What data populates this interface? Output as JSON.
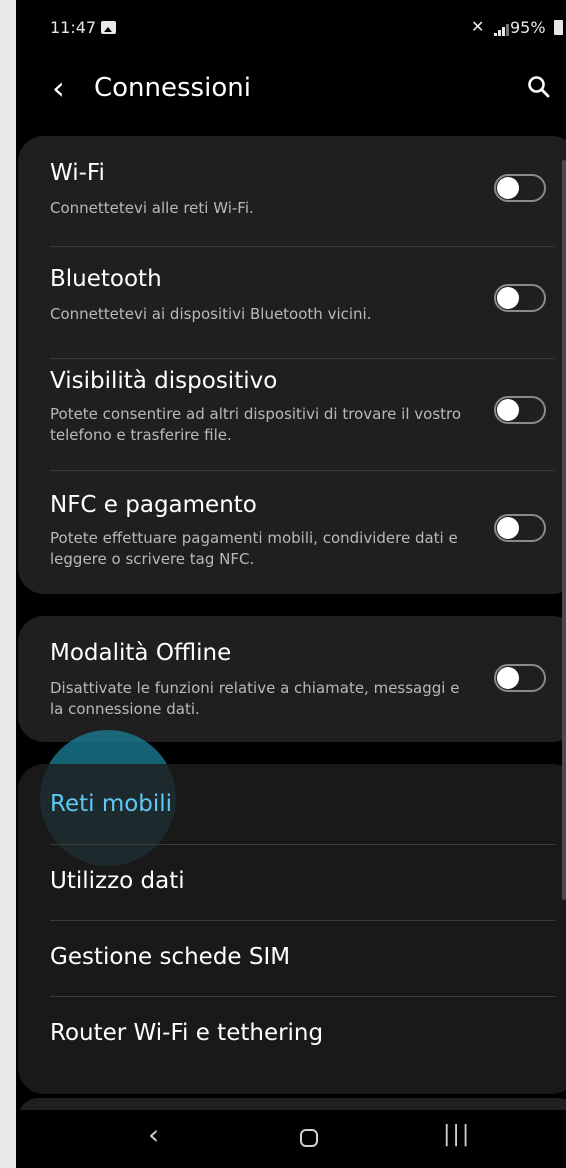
{
  "status_bar": {
    "time": "11:47",
    "battery": "95%",
    "icons": [
      "gallery-icon",
      "mute-icon",
      "signal-icon",
      "battery-icon"
    ]
  },
  "header": {
    "back_icon": "chevron-left-icon",
    "title": "Connessioni",
    "search_icon": "search-icon"
  },
  "toggle_settings": [
    {
      "title": "Wi-Fi",
      "subtitle": "Connettetevi alle reti Wi-Fi.",
      "enabled": false
    },
    {
      "title": "Bluetooth",
      "subtitle": "Connettetevi ai dispositivi Bluetooth vicini.",
      "enabled": false
    },
    {
      "title": "Visibilità dispositivo",
      "subtitle": "Potete consentire ad altri dispositivi di trovare il vostro telefono e trasferire file.",
      "enabled": false
    },
    {
      "title": "NFC e pagamento",
      "subtitle": "Potete effettuare pagamenti mobili, condividere dati e leggere o scrivere tag NFC.",
      "enabled": false
    }
  ],
  "offline": {
    "title": "Modalità Offline",
    "subtitle": "Disattivate le funzioni relative a chiamate, messaggi e la connessione dati.",
    "enabled": false
  },
  "link_settings": [
    {
      "title": "Reti mobili",
      "highlighted": true
    },
    {
      "title": "Utilizzo dati"
    },
    {
      "title": "Gestione schede SIM"
    },
    {
      "title": "Router Wi-Fi e tethering"
    }
  ],
  "colors": {
    "background": "#000000",
    "card": "#1f1f1f",
    "accent": "#5ec9f4",
    "touch_feedback": "#1b7d96"
  },
  "navigation_bar": {
    "back_icon": "nav-back-icon",
    "home_icon": "nav-home-icon",
    "recents_icon": "nav-recents-icon"
  }
}
